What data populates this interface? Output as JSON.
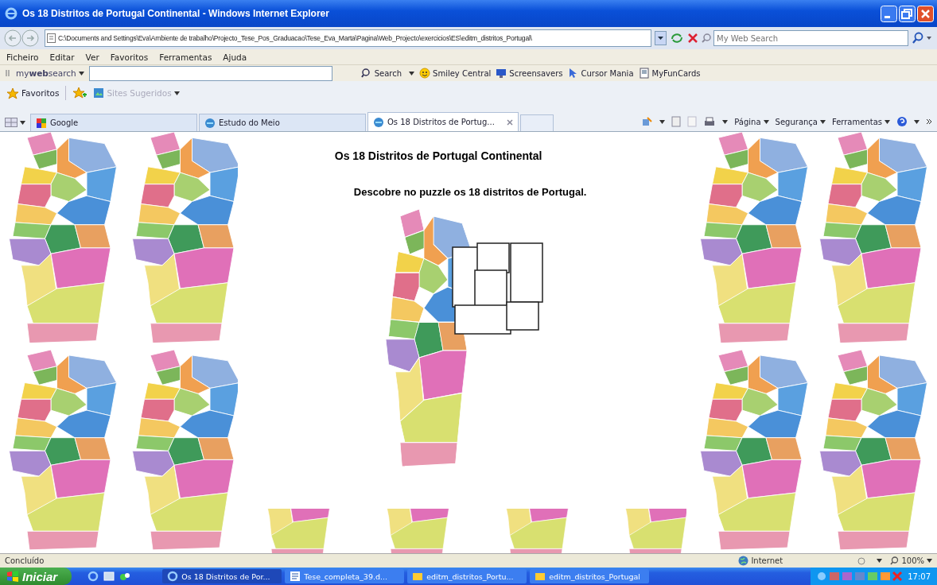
{
  "window": {
    "title": "Os 18 Distritos de Portugal Continental - Windows Internet Explorer"
  },
  "address_bar": {
    "value": "C:\\Documents and Settings\\Eva\\Ambiente de trabalho\\Projecto_Tese_Pos_Graduacao\\Tese_Eva_Marta\\Pagina\\Web_Projecto\\exercicios\\ES\\editm_distritos_Portugal\\",
    "search_placeholder": "My Web Search"
  },
  "menu": [
    "Ficheiro",
    "Editar",
    "Ver",
    "Favoritos",
    "Ferramentas",
    "Ajuda"
  ],
  "search_toolbar": {
    "brand": "my**web**search",
    "items": [
      "Search",
      "Smiley Central",
      "Screensavers",
      "Cursor Mania",
      "MyFunCards"
    ]
  },
  "favorites_bar": {
    "favorites": "Favoritos",
    "suggested": "Sites Sugeridos"
  },
  "tabs": [
    {
      "label": "Google",
      "selected": false
    },
    {
      "label": "Estudo do Meio",
      "selected": false
    },
    {
      "label": "Os 18 Distritos de Portug...",
      "selected": true
    }
  ],
  "command_bar": [
    "Página",
    "Segurança",
    "Ferramentas"
  ],
  "page": {
    "heading": "Os 18 Distritos de Portugal Continental",
    "instruction": "Descobre no puzzle os 18 distritos de Portugal."
  },
  "status_bar": {
    "status": "Concluído",
    "zone": "Internet",
    "zoom": "100%"
  },
  "taskbar": {
    "start": "Iniciar",
    "buttons": [
      {
        "label": "Os 18 Distritos de Por...",
        "selected": true
      },
      {
        "label": "Tese_completa_39.d...",
        "selected": false
      },
      {
        "label": "editm_distritos_Portu...",
        "selected": false
      },
      {
        "label": "editm_distritos_Portugal",
        "selected": false
      }
    ],
    "clock": "17:07"
  }
}
